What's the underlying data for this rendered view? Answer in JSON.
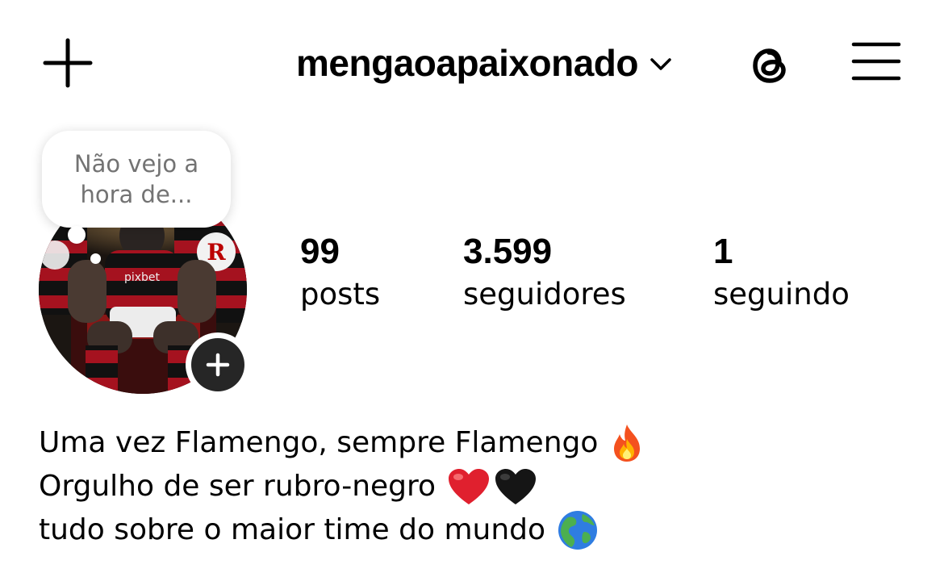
{
  "header": {
    "username": "mengaoapaixonado",
    "create_icon": "plus-icon",
    "account_switch_icon": "chevron-down-icon",
    "threads_icon": "threads-icon",
    "menu_icon": "hamburger-menu-icon"
  },
  "note": {
    "text": "Não vejo a\nhora de..."
  },
  "profile": {
    "avatar_icon": "profile-picture",
    "add_story_icon": "plus-icon"
  },
  "stats": {
    "posts": {
      "count": "99",
      "label": "posts"
    },
    "followers": {
      "count": "3.599",
      "label": "seguidores"
    },
    "following": {
      "count": "1",
      "label": "seguindo"
    }
  },
  "bio": {
    "lines": [
      {
        "text": "Uma vez Flamengo, sempre Flamengo",
        "emojis": [
          "fire-emoji"
        ]
      },
      {
        "text": "Orgulho de ser rubro-negro",
        "emojis": [
          "red-heart-emoji",
          "black-heart-emoji"
        ]
      },
      {
        "text": "tudo sobre o maior time do mundo",
        "emojis": [
          "globe-americas-emoji"
        ]
      }
    ]
  },
  "colors": {
    "text_primary": "#000000",
    "text_secondary": "#737373",
    "add_button": "#262626",
    "flamengo_red": "#c8102e",
    "flamengo_black": "#111111"
  }
}
